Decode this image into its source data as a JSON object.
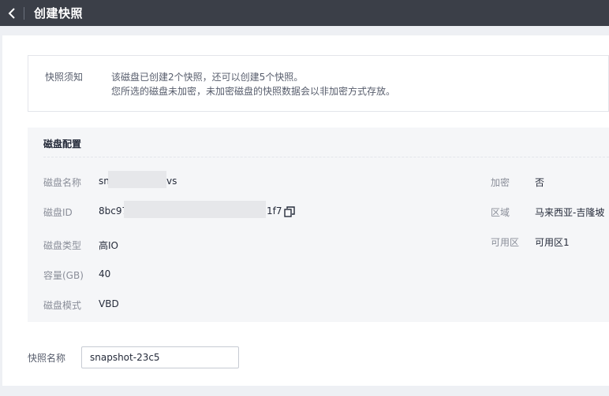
{
  "header": {
    "back_icon": "chevron-left-icon",
    "title": "创建快照"
  },
  "notice": {
    "label": "快照须知",
    "line1": "该磁盘已创建2个快照，还可以创建5个快照。",
    "line2": "您所选的磁盘未加密，未加密磁盘的快照数据会以非加密方式存放。"
  },
  "disk_config": {
    "title": "磁盘配置",
    "name_label": "磁盘名称",
    "name_prefix": "sn",
    "name_suffix": "vs",
    "id_label": "磁盘ID",
    "id_prefix": "8bc97",
    "id_suffix": "1f7",
    "copy_icon": "copy-icon",
    "type_label": "磁盘类型",
    "type_value": "高IO",
    "capacity_label": "容量(GB)",
    "capacity_value": "40",
    "mode_label": "磁盘模式",
    "mode_value": "VBD",
    "encrypt_label": "加密",
    "encrypt_value": "否",
    "region_label": "区域",
    "region_value": "马来西亚-吉隆坡",
    "az_label": "可用区",
    "az_value": "可用区1"
  },
  "snapshot": {
    "name_label": "快照名称",
    "name_value": "snapshot-23c5"
  }
}
